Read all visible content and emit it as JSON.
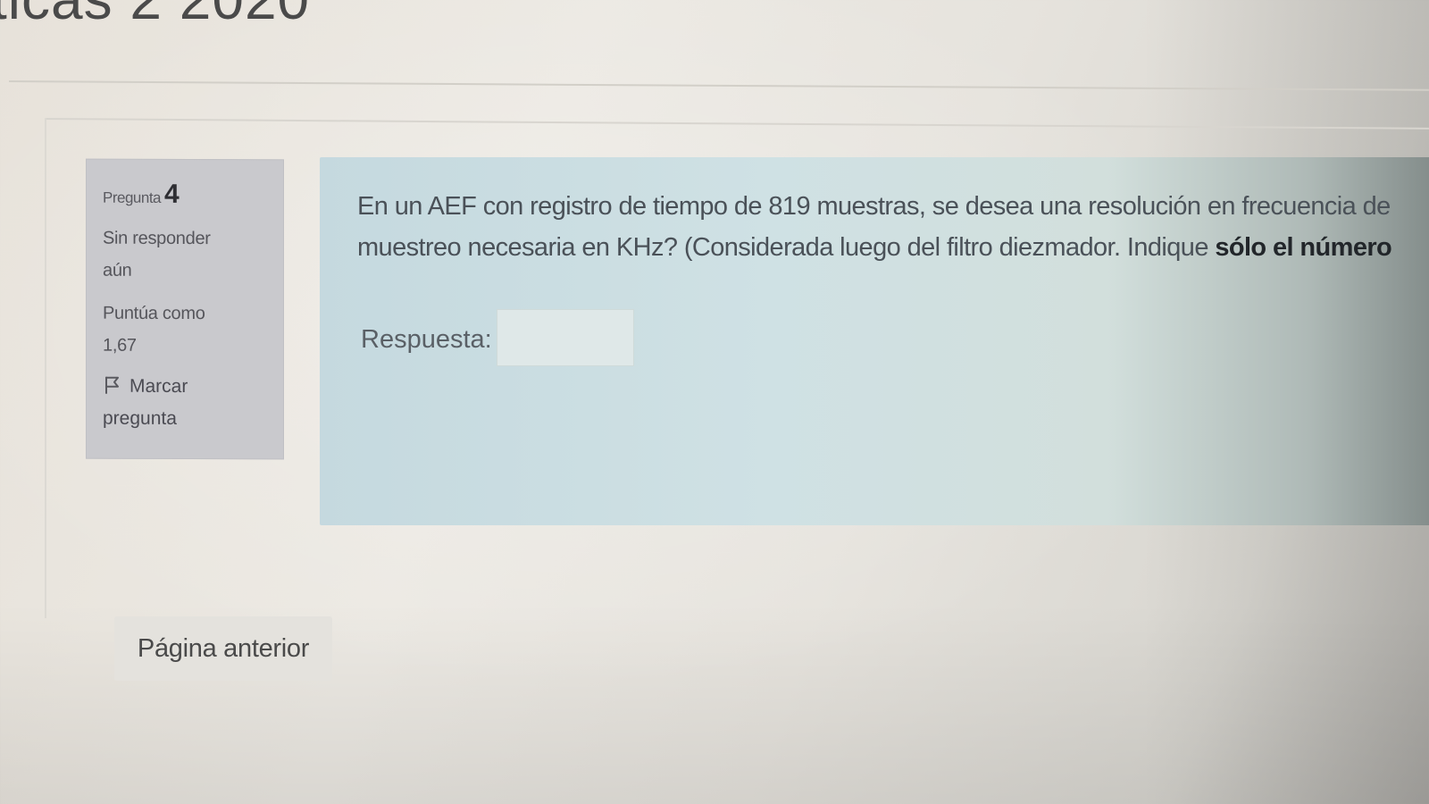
{
  "page": {
    "title": "ticas 2 2020"
  },
  "question": {
    "heading_label": "Pregunta",
    "number": "4",
    "state_line1": "Sin responder",
    "state_line2": "aún",
    "grade_label": "Puntúa como",
    "grade_value": "1,67",
    "flag_label_line1": "Marcar",
    "flag_label_line2": "pregunta",
    "flag_icon": "flag-icon",
    "text_line1": "En un AEF con registro de tiempo de 819 muestras, se desea una resolución en frecuencia de",
    "text_line2_plain": "muestreo necesaria en KHz? (Considerada luego del filtro diezmador. Indique ",
    "text_line2_bold": "sólo el número",
    "answer_label": "Respuesta:",
    "answer_value": ""
  },
  "navigation": {
    "prev_label": "Página anterior"
  },
  "colors": {
    "info_panel_bg": "#c9c9cd",
    "content_panel_bg": "#cfe1e4",
    "page_bg": "#e7e2da"
  }
}
